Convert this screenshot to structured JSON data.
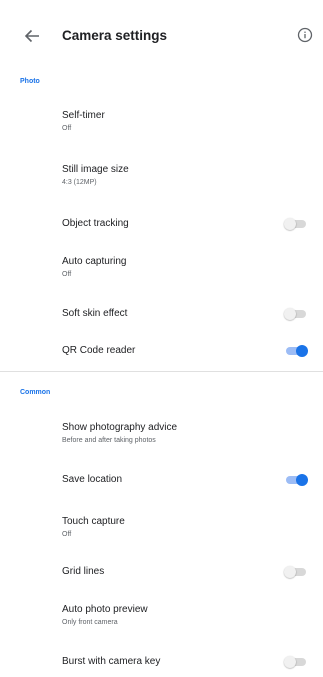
{
  "header": {
    "title": "Camera settings",
    "back_icon": "arrow-back-icon",
    "info_icon": "info-icon"
  },
  "colors": {
    "accent": "#1a73e8",
    "switch_on_track": "#9cbcf5",
    "switch_off_track": "#d8d8d8"
  },
  "photo": {
    "header": "Photo",
    "self_timer": {
      "label": "Self-timer",
      "summary": "Off"
    },
    "still_image_size": {
      "label": "Still image size",
      "summary": "4:3 (12MP)"
    },
    "object_tracking": {
      "label": "Object tracking",
      "enabled": false
    },
    "auto_capturing": {
      "label": "Auto capturing",
      "summary": "Off"
    },
    "soft_skin_effect": {
      "label": "Soft skin effect",
      "enabled": false
    },
    "qr_code_reader": {
      "label": "QR Code reader",
      "enabled": true
    }
  },
  "common": {
    "header": "Common",
    "photography_advice": {
      "label": "Show photography advice",
      "summary": "Before and after taking photos"
    },
    "save_location": {
      "label": "Save location",
      "enabled": true
    },
    "touch_capture": {
      "label": "Touch capture",
      "summary": "Off"
    },
    "grid_lines": {
      "label": "Grid lines",
      "enabled": false
    },
    "auto_photo_preview": {
      "label": "Auto photo preview",
      "summary": "Only front camera"
    },
    "burst_with_camera_key": {
      "label": "Burst with camera key",
      "enabled": false
    }
  }
}
